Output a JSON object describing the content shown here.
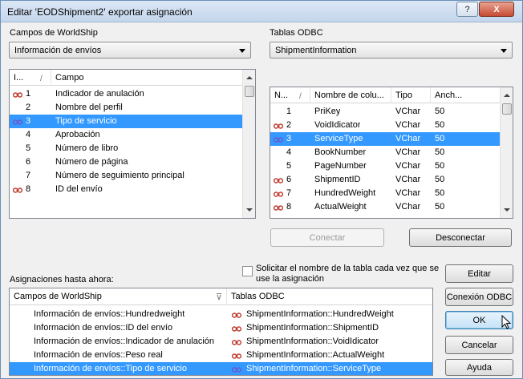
{
  "window": {
    "title": "Editar 'EODShipment2' exportar asignación",
    "help_glyph": "?",
    "close_glyph": "X"
  },
  "left_panel": {
    "label": "Campos de WorldShip",
    "combo_value": "Información de envíos",
    "columns": [
      "I...",
      "Campo"
    ],
    "sort_glyph": "/",
    "rows": [
      {
        "num": "1",
        "campo": "Indicador de anulación",
        "linked": true,
        "selected": false
      },
      {
        "num": "2",
        "campo": "Nombre del perfil",
        "linked": false,
        "selected": false
      },
      {
        "num": "3",
        "campo": "Tipo de servicio",
        "linked": true,
        "selected": true
      },
      {
        "num": "4",
        "campo": "Aprobación",
        "linked": false,
        "selected": false
      },
      {
        "num": "5",
        "campo": "Número de libro",
        "linked": false,
        "selected": false
      },
      {
        "num": "6",
        "campo": "Número de página",
        "linked": false,
        "selected": false
      },
      {
        "num": "7",
        "campo": "Número de seguimiento principal",
        "linked": false,
        "selected": false
      },
      {
        "num": "8",
        "campo": "ID del envío",
        "linked": true,
        "selected": false
      }
    ]
  },
  "right_panel": {
    "label": "Tablas ODBC",
    "combo_value": "ShipmentInformation",
    "columns": [
      "N...",
      "Nombre de colu...",
      "Tipo",
      "Anch..."
    ],
    "sort_glyph": "/",
    "rows": [
      {
        "num": "1",
        "name": "PriKey",
        "type": "VChar",
        "width": "50",
        "linked": false,
        "selected": false
      },
      {
        "num": "2",
        "name": "VoidIdicator",
        "type": "VChar",
        "width": "50",
        "linked": true,
        "selected": false
      },
      {
        "num": "3",
        "name": "ServiceType",
        "type": "VChar",
        "width": "50",
        "linked": true,
        "selected": true
      },
      {
        "num": "4",
        "name": "BookNumber",
        "type": "VChar",
        "width": "50",
        "linked": false,
        "selected": false
      },
      {
        "num": "5",
        "name": "PageNumber",
        "type": "VChar",
        "width": "50",
        "linked": false,
        "selected": false
      },
      {
        "num": "6",
        "name": "ShipmentID",
        "type": "VChar",
        "width": "50",
        "linked": true,
        "selected": false
      },
      {
        "num": "7",
        "name": "HundredWeight",
        "type": "VChar",
        "width": "50",
        "linked": true,
        "selected": false
      },
      {
        "num": "8",
        "name": "ActualWeight",
        "type": "VChar",
        "width": "50",
        "linked": true,
        "selected": false
      }
    ]
  },
  "buttons": {
    "connect": "Conectar",
    "disconnect": "Desconectar",
    "edit": "Editar",
    "odbc": "Conexión ODBC",
    "ok": "OK",
    "cancel": "Cancelar",
    "help": "Ayuda"
  },
  "checkbox_label_line1": "Solicitar el nombre de la tabla cada vez que se",
  "checkbox_label_line2": "use la asignación",
  "mappings": {
    "label": "Asignaciones hasta ahora:",
    "col1": "Campos de WorldShip",
    "col2": "Tablas ODBC",
    "rows": [
      {
        "ws": "Información de envíos::Hundredweight",
        "odbc": "ShipmentInformation::HundredWeight",
        "selected": false
      },
      {
        "ws": "Información de envíos::ID del envío",
        "odbc": "ShipmentInformation::ShipmentID",
        "selected": false
      },
      {
        "ws": "Información de envíos::Indicador de anulación",
        "odbc": "ShipmentInformation::VoidIdicator",
        "selected": false
      },
      {
        "ws": "Información de envíos::Peso real",
        "odbc": "ShipmentInformation::ActualWeight",
        "selected": false
      },
      {
        "ws": "Información de envíos::Tipo de servicio",
        "odbc": "ShipmentInformation::ServiceType",
        "selected": true
      }
    ]
  },
  "colors": {
    "selection": "#3399ff",
    "link_icon": "#c0392b",
    "link_icon_selected": "#6a5acd"
  }
}
